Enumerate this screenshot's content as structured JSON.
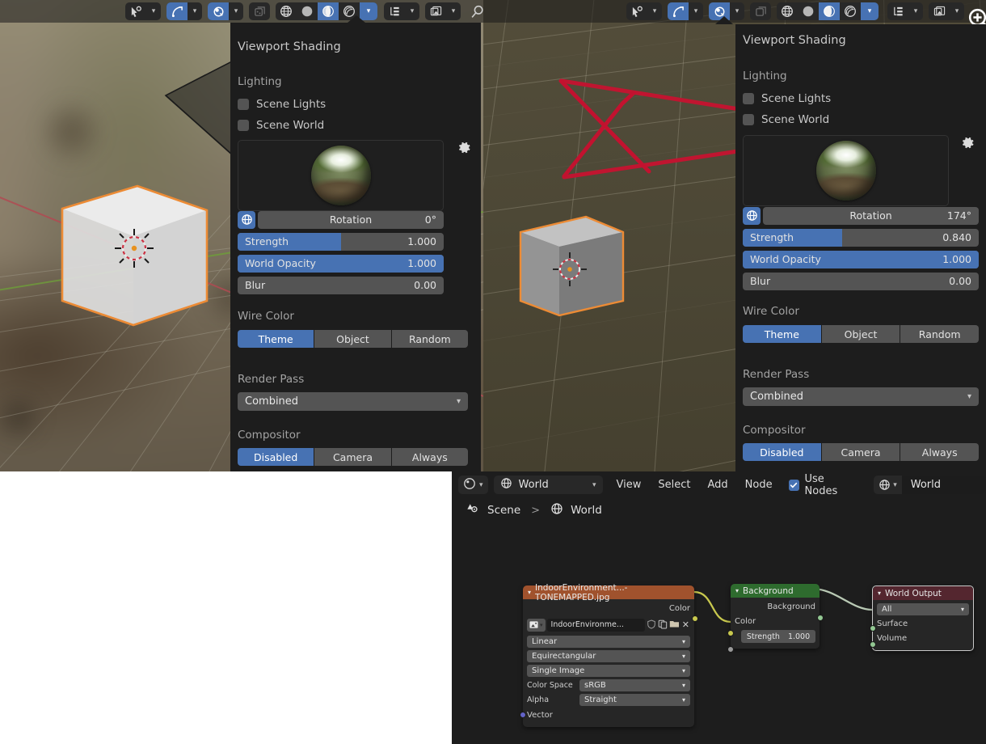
{
  "app": {
    "name": "Blender",
    "theme_accent": "#4772b3",
    "panel_bg": "#1d1d1d"
  },
  "toolbars": {
    "left": {
      "items": [
        {
          "name": "select-tool",
          "icon": "cursor-select-icon",
          "state": "off"
        },
        {
          "name": "transform-orientation",
          "icon": "arc-arrow-icon",
          "state": "on"
        },
        {
          "name": "snapping",
          "icon": "magnet-icon",
          "state": "on"
        },
        {
          "name": "proportional-editing",
          "icon": "proportional-icon",
          "state": "dim"
        },
        {
          "name": "shading-wireframe",
          "icon": "globe-wire-icon",
          "state": "off"
        },
        {
          "name": "shading-solid",
          "icon": "sphere-icon",
          "state": "off"
        },
        {
          "name": "shading-material-preview",
          "icon": "material-sphere-icon",
          "state": "on"
        },
        {
          "name": "shading-rendered",
          "icon": "rendered-sphere-icon",
          "state": "off"
        },
        {
          "name": "shading-dropdown",
          "icon": "chevron-down-icon",
          "state": "on"
        },
        {
          "name": "outliner-filter",
          "icon": "outliner-icon",
          "state": "off"
        },
        {
          "name": "overlays",
          "icon": "image-stack-icon",
          "state": "off"
        },
        {
          "name": "search",
          "icon": "search-icon",
          "state": "off"
        }
      ]
    }
  },
  "viewport_left": {
    "name": "3d-viewport-material-preview",
    "background": "blurred-forest-hdri",
    "object": "cube-selected"
  },
  "viewport_right": {
    "name": "3d-viewport-material-preview",
    "background": "olive-floor-grid",
    "object": "cube-selected",
    "annotation": "red-x-stroke"
  },
  "popover_left": {
    "title": "Viewport Shading",
    "lighting_label": "Lighting",
    "checkboxes": [
      {
        "label": "Scene Lights",
        "checked": false
      },
      {
        "label": "Scene World",
        "checked": false
      }
    ],
    "hdri_preview": "forest-hdri-sphere",
    "gear_icon": "gear-icon",
    "rotation": {
      "label": "Rotation",
      "value": "0°",
      "fill_pct": 0
    },
    "strength": {
      "label": "Strength",
      "value": "1.000",
      "fill_pct": 50
    },
    "world_opacity": {
      "label": "World Opacity",
      "value": "1.000",
      "fill_pct": 100
    },
    "blur": {
      "label": "Blur",
      "value": "0.00",
      "fill_pct": 0
    },
    "wire_color_label": "Wire Color",
    "wire_color_options": [
      "Theme",
      "Object",
      "Random"
    ],
    "wire_color_selected": "Theme",
    "render_pass_label": "Render Pass",
    "render_pass_value": "Combined",
    "compositor_label": "Compositor",
    "compositor_options": [
      "Disabled",
      "Camera",
      "Always"
    ],
    "compositor_selected": "Disabled"
  },
  "popover_right": {
    "title": "Viewport Shading",
    "lighting_label": "Lighting",
    "checkboxes": [
      {
        "label": "Scene Lights",
        "checked": false
      },
      {
        "label": "Scene World",
        "checked": false
      }
    ],
    "hdri_preview": "forest-hdri-sphere",
    "gear_icon": "gear-icon",
    "rotation": {
      "label": "Rotation",
      "value": "174°",
      "fill_pct": 0
    },
    "strength": {
      "label": "Strength",
      "value": "0.840",
      "fill_pct": 42
    },
    "world_opacity": {
      "label": "World Opacity",
      "value": "1.000",
      "fill_pct": 100
    },
    "blur": {
      "label": "Blur",
      "value": "0.00",
      "fill_pct": 0
    },
    "wire_color_label": "Wire Color",
    "wire_color_options": [
      "Theme",
      "Object",
      "Random"
    ],
    "wire_color_selected": "Theme",
    "render_pass_label": "Render Pass",
    "render_pass_value": "Combined",
    "compositor_label": "Compositor",
    "compositor_options": [
      "Disabled",
      "Camera",
      "Always"
    ],
    "compositor_selected": "Disabled"
  },
  "shader_editor": {
    "editor_type_icon": "shader-editor-icon",
    "shader_type_icon": "world-globe-icon",
    "shader_type_value": "World",
    "menus": [
      "View",
      "Select",
      "Add",
      "Node"
    ],
    "use_nodes": {
      "label": "Use Nodes",
      "checked": true
    },
    "world_selector_icon": "world-globe-icon",
    "world_selector_value": "World",
    "breadcrumb": [
      {
        "icon": "scene-icon",
        "label": "Scene"
      },
      {
        "icon": "world-globe-icon",
        "label": "World"
      }
    ],
    "nodes": [
      {
        "id": "env-texture",
        "title": "IndoorEnvironment...-TONEMAPPED.jpg",
        "header_color": "#a0522d",
        "outputs": [
          "Color"
        ],
        "image_field": {
          "value": "IndoorEnvironme...",
          "buttons": [
            "shield-icon",
            "copy-icon",
            "folder-icon",
            "close-icon"
          ]
        },
        "dropdowns": [
          "Linear",
          "Equirectangular",
          "Single Image"
        ],
        "props": [
          {
            "label": "Color Space",
            "value": "sRGB"
          },
          {
            "label": "Alpha",
            "value": "Straight"
          }
        ],
        "inputs": [
          "Vector"
        ]
      },
      {
        "id": "background",
        "title": "Background",
        "header_color": "#2e6b2e",
        "outputs": [
          "Background"
        ],
        "inputs": [
          "Color"
        ],
        "strength": {
          "label": "Strength",
          "value": "1.000"
        }
      },
      {
        "id": "world-output",
        "title": "World Output",
        "header_color": "#54262f",
        "dropdown": "All",
        "inputs": [
          "Surface",
          "Volume"
        ]
      }
    ]
  },
  "cursor": {
    "icon": "zoom-cursor-icon"
  }
}
